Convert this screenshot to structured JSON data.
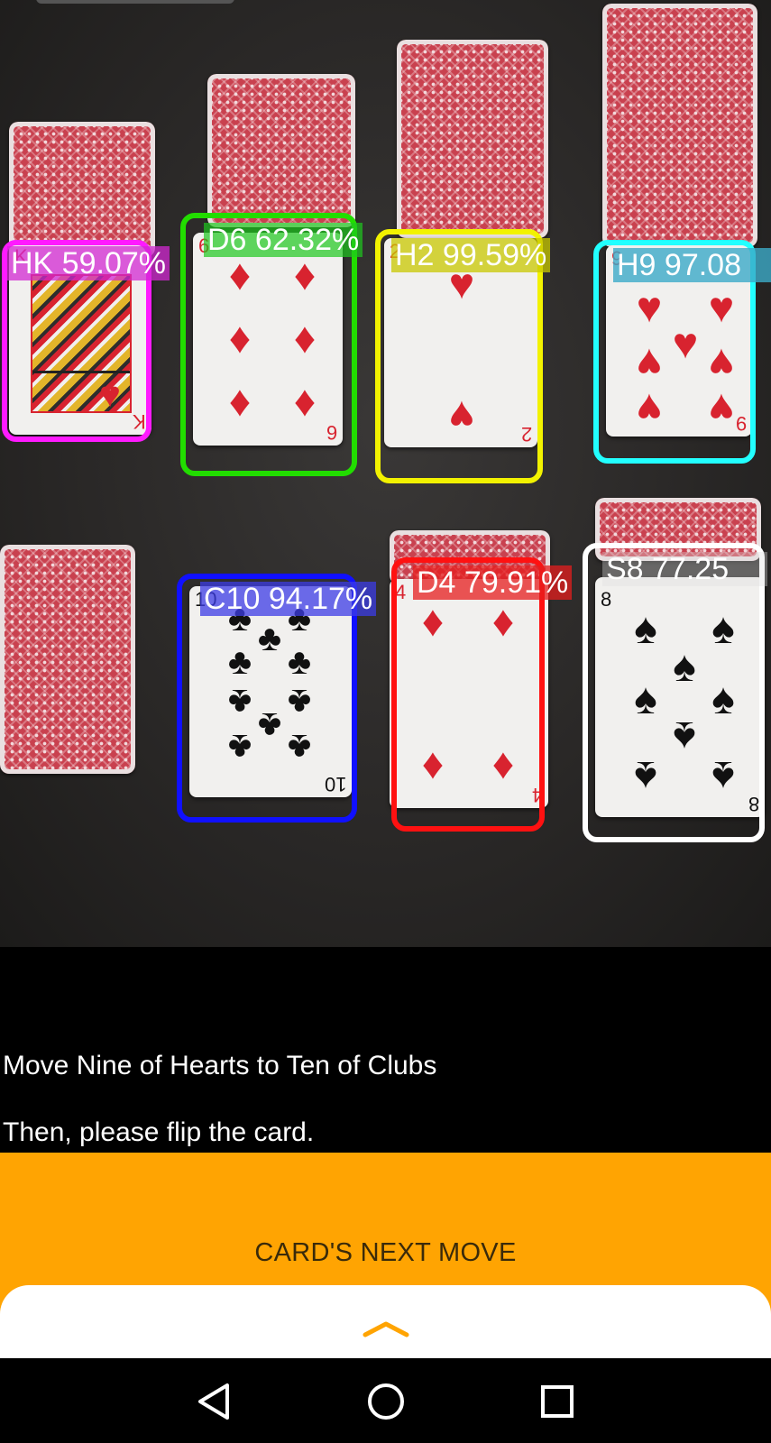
{
  "detections": [
    {
      "label": "HK 59.07%",
      "color": "#ff1aff"
    },
    {
      "label": "D6 62.32%",
      "color": "#22dd00"
    },
    {
      "label": "H2 99.59%",
      "color": "#f2f200"
    },
    {
      "label": "H9 97.08",
      "color": "#22ffff"
    },
    {
      "label": "C10 94.17%",
      "color": "#1010ff"
    },
    {
      "label": "D4 79.91%",
      "color": "#ff1111"
    },
    {
      "label": "S8 77.25",
      "color": "#ffffff"
    }
  ],
  "card_ranks": {
    "king": "K",
    "six": "6",
    "two": "2",
    "nine": "9",
    "ten": "10",
    "four": "4",
    "eight": "8"
  },
  "instruction": {
    "line1": "Move Nine of Hearts to Ten of Clubs",
    "line2": "Then, please flip the card."
  },
  "next_move_button": "CARD'S NEXT MOVE",
  "icons": {
    "sheet_handle": "chevron-up-icon",
    "nav_back": "back-triangle-icon",
    "nav_home": "home-circle-icon",
    "nav_recents": "recents-square-icon"
  },
  "colors": {
    "accent": "#ffa402"
  }
}
